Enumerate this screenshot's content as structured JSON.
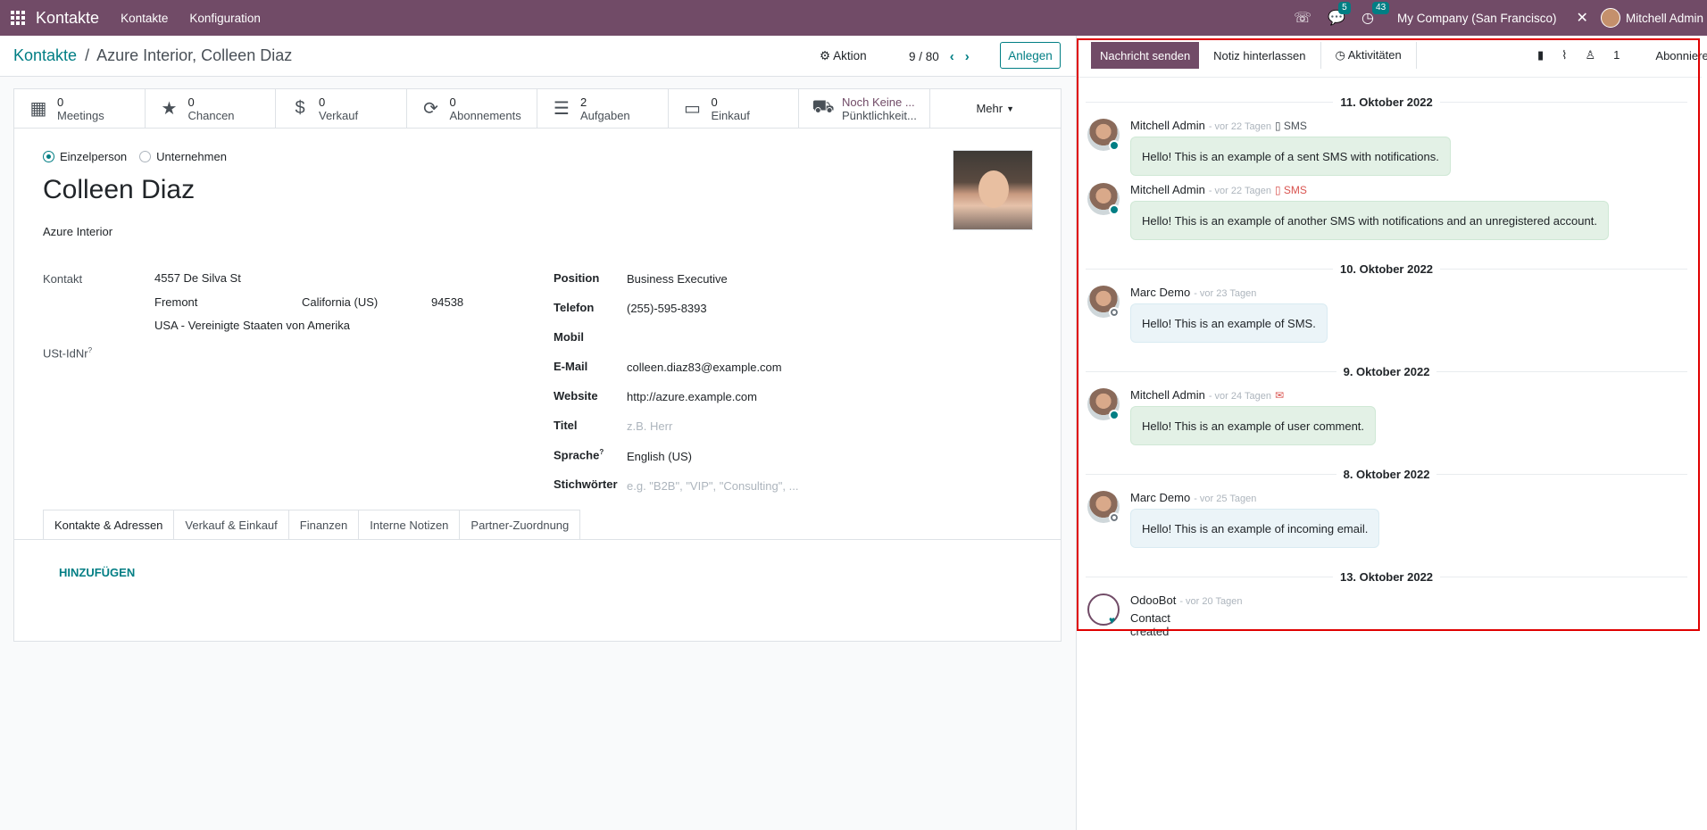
{
  "nav": {
    "brand": "Kontakte",
    "links": [
      "Kontakte",
      "Konfiguration"
    ],
    "badge_chat": "5",
    "badge_activity": "43",
    "company": "My Company (San Francisco)",
    "user": "Mitchell Admin"
  },
  "control": {
    "breadcrumb_root": "Kontakte",
    "breadcrumb_sep": "/",
    "breadcrumb_current": "Azure Interior, Colleen Diaz",
    "action": "Aktion",
    "pager": "9 / 80",
    "create": "Anlegen"
  },
  "smart": [
    {
      "icon": "calendar-icon",
      "count": "0",
      "label": "Meetings"
    },
    {
      "icon": "star-icon",
      "count": "0",
      "label": "Chancen"
    },
    {
      "icon": "dollar-icon",
      "count": "0",
      "label": "Verkauf"
    },
    {
      "icon": "refresh-icon",
      "count": "0",
      "label": "Abonnements"
    },
    {
      "icon": "tasks-icon",
      "count": "2",
      "label": "Aufgaben"
    },
    {
      "icon": "credit-card-icon",
      "count": "0",
      "label": "Einkauf"
    },
    {
      "icon": "truck-icon",
      "count": "Noch Keine ...",
      "label": "Pünktlichkeit..."
    },
    {
      "label": "Mehr"
    }
  ],
  "form": {
    "type_person": "Einzelperson",
    "type_company": "Unternehmen",
    "name": "Colleen Diaz",
    "company": "Azure Interior",
    "labels": {
      "contact": "Kontakt",
      "vat": "USt-IdNr",
      "position": "Position",
      "phone": "Telefon",
      "mobile": "Mobil",
      "email": "E-Mail",
      "website": "Website",
      "title": "Titel",
      "language": "Sprache",
      "tags": "Stichwörter"
    },
    "address": {
      "street": "4557 De Silva St",
      "city": "Fremont",
      "state": "California (US)",
      "zip": "94538",
      "country": "USA - Vereinigte Staaten von Amerika"
    },
    "values": {
      "position": "Business Executive",
      "phone": "(255)-595-8393",
      "email": "colleen.diaz83@example.com",
      "website": "http://azure.example.com",
      "title_placeholder": "z.B. Herr",
      "language": "English (US)",
      "tags_placeholder": "e.g. \"B2B\", \"VIP\", \"Consulting\", ..."
    },
    "tabs": [
      "Kontakte & Adressen",
      "Verkauf & Einkauf",
      "Finanzen",
      "Interne Notizen",
      "Partner-Zuordnung"
    ],
    "add": "HINZUFÜGEN"
  },
  "chatter": {
    "send": "Nachricht senden",
    "note": "Notiz hinterlassen",
    "activities": "Aktivitäten",
    "followers": "1",
    "subscribe": "Abonnieren",
    "messages": [
      {
        "date": "11. Oktober 2022"
      },
      {
        "author": "Mitchell Admin",
        "time": "- vor 22 Tagen",
        "kind": "SMS",
        "body": "Hello! This is an example of a sent SMS with notifications."
      },
      {
        "author": "Mitchell Admin",
        "time": "- vor 22 Tagen",
        "kind": "SMS",
        "body": "Hello! This is an example of another SMS with notifications and an unregistered account."
      },
      {
        "date": "10. Oktober 2022"
      },
      {
        "author": "Marc Demo",
        "time": "- vor 23 Tagen",
        "body": "Hello! This is an example of SMS."
      },
      {
        "date": "9. Oktober 2022"
      },
      {
        "author": "Mitchell Admin",
        "time": "- vor 24 Tagen",
        "body": "Hello! This is an example of user comment."
      },
      {
        "date": "8. Oktober 2022"
      },
      {
        "author": "Marc Demo",
        "time": "- vor 25 Tagen",
        "body": "Hello! This is an example of incoming email."
      },
      {
        "date": "13. Oktober 2022"
      },
      {
        "author": "OdooBot",
        "time": "- vor 20 Tagen",
        "body": "Contact created"
      }
    ]
  }
}
